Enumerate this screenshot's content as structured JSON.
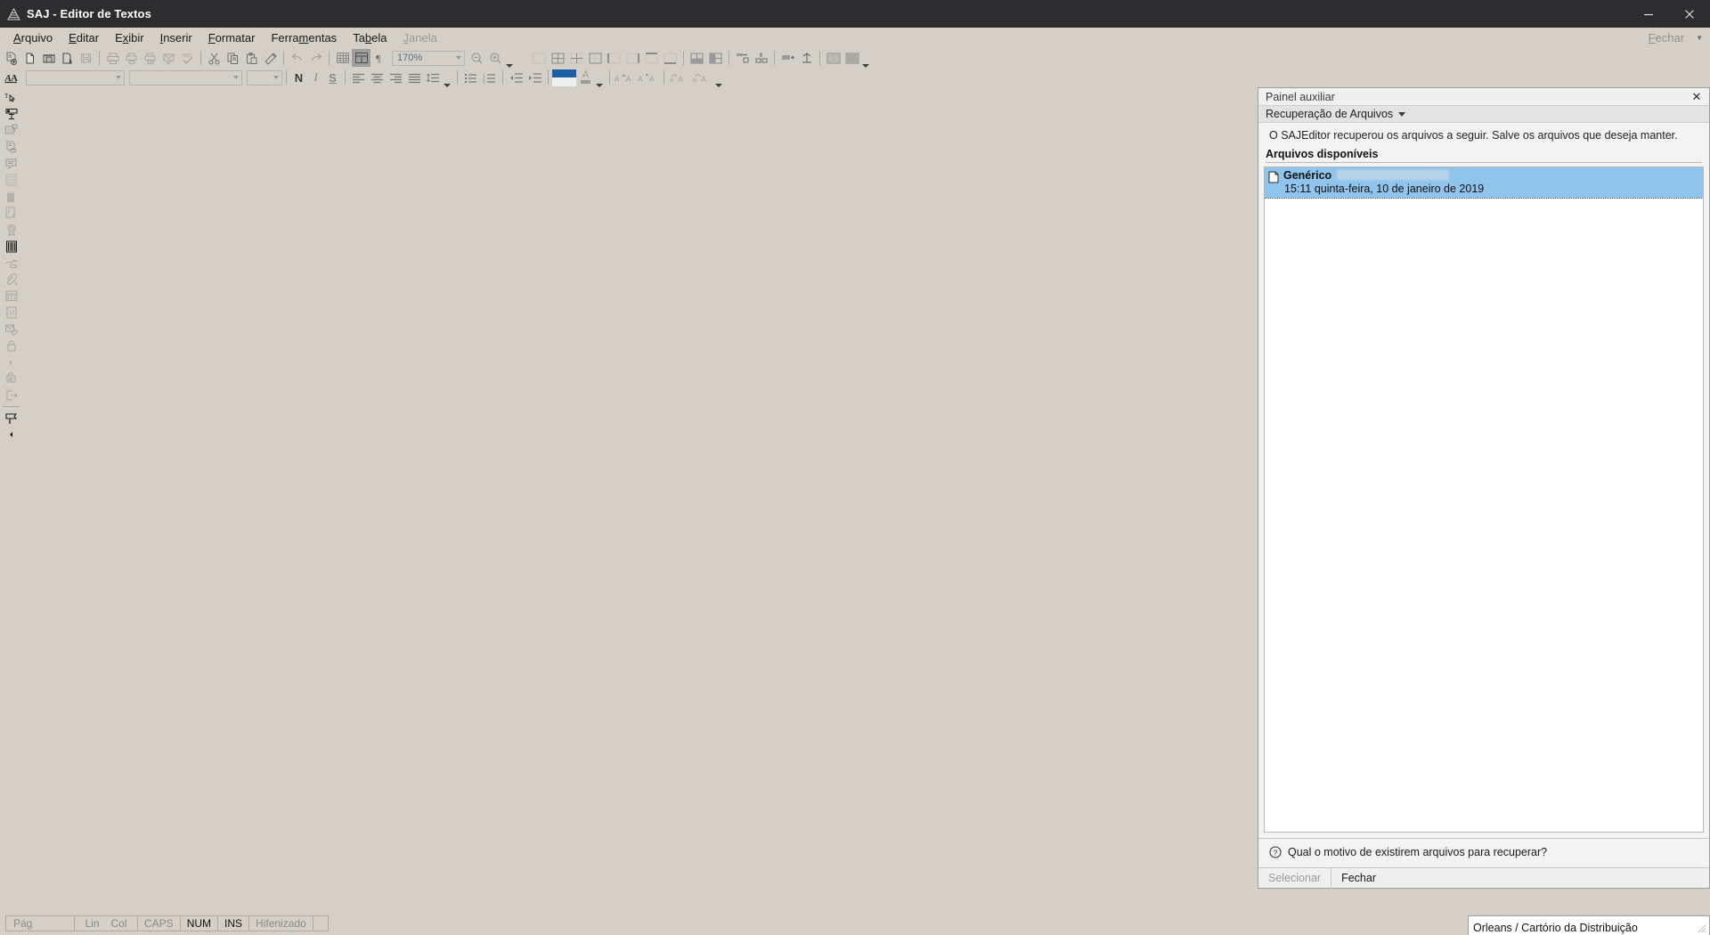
{
  "window": {
    "title": "SAJ - Editor de Textos",
    "app_icon": "saj-logo-icon",
    "minimize_label": "—",
    "close_label": "✕"
  },
  "menubar": {
    "items": [
      {
        "label": "Arquivo",
        "accel": "A",
        "disabled": false
      },
      {
        "label": "Editar",
        "accel": "E",
        "disabled": false
      },
      {
        "label": "Exibir",
        "accel": "x",
        "disabled": false
      },
      {
        "label": "Inserir",
        "accel": "I",
        "disabled": false
      },
      {
        "label": "Formatar",
        "accel": "F",
        "disabled": false
      },
      {
        "label": "Ferramentas",
        "accel": "m",
        "disabled": false
      },
      {
        "label": "Tabela",
        "accel": "b",
        "disabled": false
      },
      {
        "label": "Janela",
        "accel": "J",
        "disabled": true
      }
    ],
    "right": {
      "label": "Fechar",
      "accel": "F"
    }
  },
  "toolbar_main": {
    "zoom_value": "170%",
    "buttons": [
      {
        "name": "new-document-icon",
        "tip": "Novo"
      },
      {
        "name": "blank-page-icon",
        "tip": "Novo em branco"
      },
      {
        "name": "open-folder-icon",
        "tip": "Abrir"
      },
      {
        "name": "open-model-icon",
        "tip": "Abrir modelo"
      },
      {
        "name": "save-icon",
        "tip": "Salvar"
      },
      {
        "name": "print-icon",
        "tip": "Imprimir"
      },
      {
        "name": "print-quick-icon",
        "tip": "Impressão rápida"
      },
      {
        "name": "print-preview-icon",
        "tip": "Visualizar impressão"
      },
      {
        "name": "send-mail-icon",
        "tip": "Enviar"
      },
      {
        "name": "spellcheck-icon",
        "tip": "Ortografia"
      },
      {
        "name": "cut-icon",
        "tip": "Recortar"
      },
      {
        "name": "copy-icon",
        "tip": "Copiar"
      },
      {
        "name": "paste-icon",
        "tip": "Colar"
      },
      {
        "name": "format-painter-icon",
        "tip": "Pincel de formatação"
      },
      {
        "name": "undo-icon",
        "tip": "Desfazer"
      },
      {
        "name": "redo-icon",
        "tip": "Refazer"
      },
      {
        "name": "show-grid-icon",
        "tip": "Exibir grade"
      },
      {
        "name": "page-layout-icon",
        "tip": "Layout de página"
      },
      {
        "name": "pilcrow-icon",
        "tip": "Marcas de parágrafo"
      },
      {
        "name": "zoom-out-icon",
        "tip": "Reduzir zoom"
      },
      {
        "name": "zoom-in-icon",
        "tip": "Ampliar zoom"
      },
      {
        "name": "zoom-menu-icon",
        "tip": "Mais zoom"
      },
      {
        "name": "table-none-icon",
        "tip": "Sem bordas"
      },
      {
        "name": "table-all-icon",
        "tip": "Todas as bordas"
      },
      {
        "name": "table-inner-icon",
        "tip": "Bordas internas"
      },
      {
        "name": "table-outer-icon",
        "tip": "Borda externa"
      },
      {
        "name": "table-left-icon",
        "tip": "Borda esquerda"
      },
      {
        "name": "table-right-icon",
        "tip": "Borda direita"
      },
      {
        "name": "table-top-icon",
        "tip": "Borda superior"
      },
      {
        "name": "table-bottom-icon",
        "tip": "Borda inferior"
      },
      {
        "name": "merge-cells-icon",
        "tip": "Mesclar células"
      },
      {
        "name": "split-cells-icon",
        "tip": "Dividir células"
      },
      {
        "name": "insert-row-icon",
        "tip": "Inserir linha"
      },
      {
        "name": "insert-column-icon",
        "tip": "Inserir coluna"
      },
      {
        "name": "delete-row-icon",
        "tip": "Excluir linha"
      },
      {
        "name": "delete-column-icon",
        "tip": "Excluir coluna"
      },
      {
        "name": "shading-icon",
        "tip": "Sombreamento"
      },
      {
        "name": "shading-alt-icon",
        "tip": "Sombreamento alternado"
      }
    ]
  },
  "toolbar_format": {
    "style_value": "",
    "style_placeholder": "",
    "font_value": "",
    "font_placeholder": "",
    "size_value": "",
    "size_placeholder": "",
    "bold_label": "N",
    "italic_label": "I",
    "underline_label": "S",
    "highlight_color": "#1f5fa6",
    "buttons": [
      {
        "name": "font-dialog-icon",
        "tip": "Fonte"
      },
      {
        "name": "align-left-icon",
        "tip": "Alinhar à esquerda"
      },
      {
        "name": "align-center-icon",
        "tip": "Centralizar"
      },
      {
        "name": "align-right-icon",
        "tip": "Alinhar à direita"
      },
      {
        "name": "align-justify-icon",
        "tip": "Justificar"
      },
      {
        "name": "line-spacing-icon",
        "tip": "Espaçamento entre linhas"
      },
      {
        "name": "bullet-list-icon",
        "tip": "Marcadores"
      },
      {
        "name": "numbered-list-icon",
        "tip": "Numeração"
      },
      {
        "name": "decrease-indent-icon",
        "tip": "Diminuir recuo"
      },
      {
        "name": "increase-indent-icon",
        "tip": "Aumentar recuo"
      },
      {
        "name": "highlight-color-icon",
        "tip": "Cor de realce"
      },
      {
        "name": "font-color-icon",
        "tip": "Cor da fonte"
      },
      {
        "name": "grow-font-icon",
        "tip": "Aumentar fonte"
      },
      {
        "name": "shrink-font-icon",
        "tip": "Diminuir fonte"
      },
      {
        "name": "uppercase-icon",
        "tip": "Maiúsculas"
      },
      {
        "name": "lowercase-icon",
        "tip": "Minúsculas"
      },
      {
        "name": "more-format-icon",
        "tip": "Mais"
      }
    ]
  },
  "left_rail": {
    "buttons": [
      {
        "name": "text-cursor-icon",
        "tip": "Selecionar texto",
        "dark": true
      },
      {
        "name": "text-field-icon",
        "tip": "Campo de texto",
        "dark": true
      },
      {
        "name": "insert-field-icon",
        "tip": "Inserir campo",
        "dark": false
      },
      {
        "name": "document-view-icon",
        "tip": "Visualizar documento",
        "dark": false
      },
      {
        "name": "comment-icon",
        "tip": "Comentário",
        "dark": false
      },
      {
        "name": "list-view-icon",
        "tip": "Lista",
        "dark": false
      },
      {
        "name": "block-icon",
        "tip": "Bloco",
        "dark": false
      },
      {
        "name": "remove-field-icon",
        "tip": "Remover campo",
        "dark": false
      },
      {
        "name": "seal-icon",
        "tip": "Selo",
        "dark": false
      },
      {
        "name": "barcode-icon",
        "tip": "Código de barras",
        "dark": true
      },
      {
        "name": "signature-icon",
        "tip": "Assinatura",
        "dark": false
      },
      {
        "name": "attach-icon",
        "tip": "Anexo",
        "dark": false
      },
      {
        "name": "calendar-icon",
        "tip": "Calendário",
        "dark": false
      },
      {
        "name": "model-icon",
        "tip": "Modelo",
        "dark": false
      },
      {
        "name": "edit-tag-icon",
        "tip": "Marcação",
        "dark": false
      },
      {
        "name": "lock-icon",
        "tip": "Bloquear",
        "dark": false
      },
      {
        "name": "play-small-icon",
        "tip": "Executar",
        "dark": false
      },
      {
        "name": "stamp-icon",
        "tip": "Carimbo",
        "dark": false
      },
      {
        "name": "export-icon",
        "tip": "Exportar",
        "dark": false
      },
      {
        "name": "flag-icon",
        "tip": "Sinalizador",
        "dark": true
      },
      {
        "name": "collapse-rail-icon",
        "tip": "Recolher",
        "dark": true
      }
    ]
  },
  "panel": {
    "title": "Painel auxiliar",
    "close_icon": "✕",
    "section_title": "Recuperação de Arquivos",
    "description": "O SAJEditor recuperou os arquivos a seguir. Salve os arquivos que deseja manter.",
    "subheading": "Arquivos disponíveis",
    "files": [
      {
        "icon": "document-icon",
        "name": "Genérico",
        "redacted": true,
        "date": "15:11 quinta-feira, 10 de janeiro de 2019",
        "selected": true
      }
    ],
    "help_link": "Qual o motivo de existirem arquivos para recuperar?",
    "help_icon": "question-mark-icon",
    "actions": [
      {
        "label": "Selecionar",
        "disabled": true
      },
      {
        "label": "Fechar",
        "disabled": false
      }
    ],
    "selection_color": "#8fc4ec"
  },
  "statusbar": {
    "cells": [
      {
        "name": "page",
        "label": "Pág",
        "active": false
      },
      {
        "name": "line",
        "label": "Lin",
        "active": false
      },
      {
        "name": "column",
        "label": "Col",
        "active": false
      },
      {
        "name": "caps",
        "label": "CAPS",
        "active": false
      },
      {
        "name": "num",
        "label": "NUM",
        "active": true
      },
      {
        "name": "ins",
        "label": "INS",
        "active": true
      },
      {
        "name": "hyphen",
        "label": "Hifenizado",
        "active": false
      }
    ]
  },
  "background_window": {
    "text": "Orleans / Cartório da Distribuição"
  }
}
